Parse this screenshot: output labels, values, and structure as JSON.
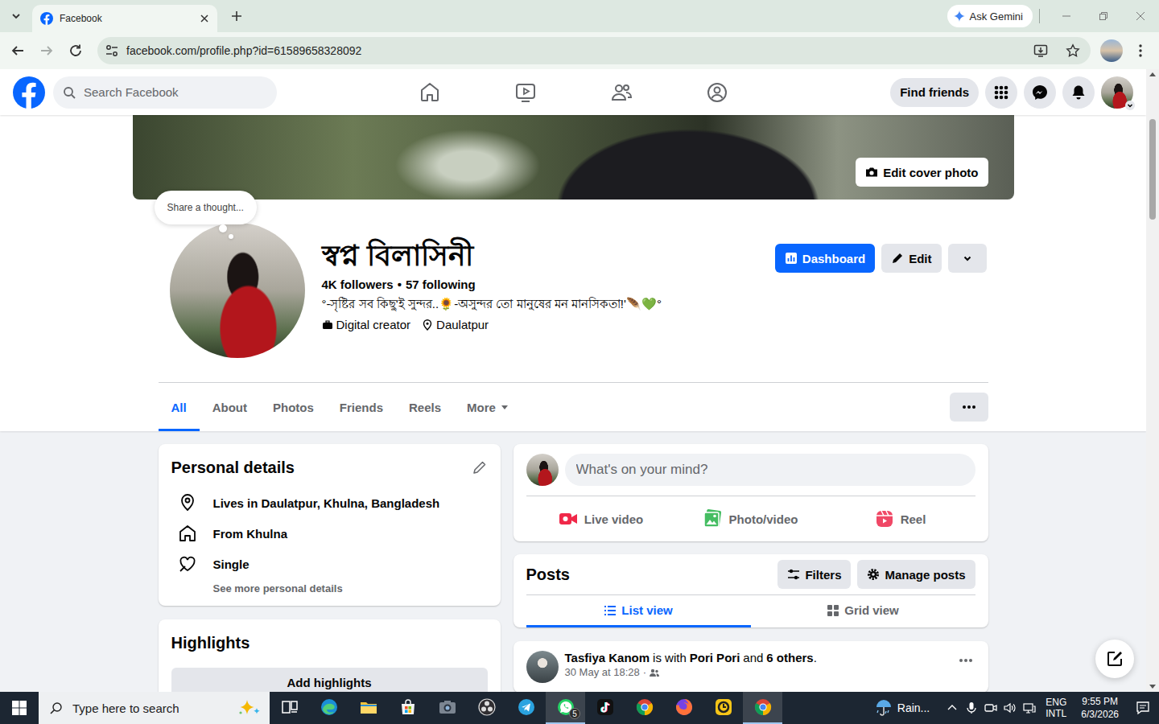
{
  "browser": {
    "tabs": [
      {
        "label": "Facebook",
        "selected": true
      }
    ],
    "ask_gemini": "Ask Gemini",
    "forward_disabled": true,
    "url": "facebook.com/profile.php?id=61589658328092"
  },
  "fb_nav": {
    "search": {
      "placeholder": "Search Facebook"
    },
    "items": [
      {
        "kind": "home",
        "selected": false
      },
      {
        "kind": "video",
        "selected": false
      },
      {
        "kind": "friends",
        "selected": false
      },
      {
        "kind": "groups",
        "selected": false
      }
    ],
    "find_friends": "Find friends"
  },
  "cover": {
    "edit_button": "Edit cover photo"
  },
  "profile": {
    "thought": "Share a thought...",
    "name": "স্বপ্ন বিলাসিনী",
    "followers": "4K followers",
    "separator": "•",
    "following": "57 following",
    "bio": "°-সৃষ্টির সব কিছু'ই সুন্দর..🌻-অসুন্দর তো মানুষের মন মানসিকতা!'🪶💚°",
    "category": "Digital creator",
    "location": "Daulatpur",
    "dashboard": "Dashboard",
    "edit": "Edit"
  },
  "profile_tabs": [
    {
      "label": "All",
      "selected": true
    },
    {
      "label": "About",
      "selected": false
    },
    {
      "label": "Photos",
      "selected": false
    },
    {
      "label": "Friends",
      "selected": false
    },
    {
      "label": "Reels",
      "selected": false
    },
    {
      "label": "More",
      "selected": false
    }
  ],
  "personal_details": {
    "title": "Personal details",
    "items": [
      {
        "kind": "location",
        "text": "Lives in Daulatpur, Khulna, Bangladesh"
      },
      {
        "kind": "home",
        "text": "From Khulna"
      },
      {
        "kind": "relationship",
        "text": "Single"
      }
    ],
    "more_link": "See more personal details"
  },
  "highlights": {
    "title": "Highlights",
    "button": "Add highlights"
  },
  "composer": {
    "placeholder": "What's on your mind?",
    "actions": [
      {
        "kind": "live",
        "label": "Live video"
      },
      {
        "kind": "photo",
        "label": "Photo/video"
      },
      {
        "kind": "reel",
        "label": "Reel"
      }
    ]
  },
  "posts": {
    "title": "Posts",
    "filters": "Filters",
    "manage": "Manage posts",
    "views": [
      {
        "kind": "list",
        "label": "List view",
        "selected": true
      },
      {
        "kind": "grid",
        "label": "Grid view",
        "selected": false
      }
    ]
  },
  "post": {
    "author": "Tasfiya Kanom",
    "with_text": "is with",
    "tagged": "Pori Pori",
    "and_text": "and",
    "others": "6 others",
    "period": ".",
    "time": "30 May at 18:28",
    "dot": "·"
  },
  "taskbar": {
    "search_placeholder": "Type here to search",
    "apps": [
      {
        "kind": "taskview",
        "active": false
      },
      {
        "kind": "edge",
        "active": false
      },
      {
        "kind": "explorer",
        "active": false
      },
      {
        "kind": "store",
        "active": false
      },
      {
        "kind": "camera",
        "active": false
      },
      {
        "kind": "obs",
        "active": false
      },
      {
        "kind": "telegram",
        "active": false
      },
      {
        "kind": "whatsapp",
        "active": true,
        "badge": "5"
      },
      {
        "kind": "tiktok",
        "active": false
      },
      {
        "kind": "chrome",
        "active": false
      },
      {
        "kind": "firefox",
        "active": false
      },
      {
        "kind": "yellowapp",
        "active": false
      },
      {
        "kind": "chrome",
        "active": true
      }
    ],
    "weather": "Rain...",
    "lang": "ENG",
    "layout": "INTL",
    "time": "9:55 PM",
    "date": "6/3/2026"
  }
}
